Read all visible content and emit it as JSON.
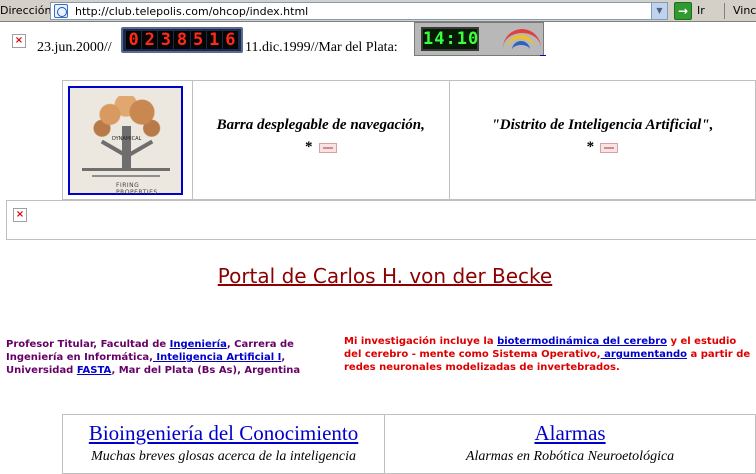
{
  "browser": {
    "address_label": "Dirección",
    "url": "http://club.telepolis.com/ohcop/index.html",
    "go_label": "Ir",
    "links_label": "Vincu"
  },
  "header": {
    "date_left": "23.jun.2000//",
    "counter_digits": [
      "0",
      "2",
      "3",
      "8",
      "5",
      "1",
      "6"
    ],
    "date_right": "11.dic.1999//Mar del Plata:",
    "clock_time": "14:10"
  },
  "nav": {
    "logo_tag": "DYNAMICAL",
    "logo_caption": "FIRING PROPERTIES",
    "cell1_text": "Barra desplegable de navegación,",
    "cell1_star": "*",
    "cell2_text": "\"Distrito de Inteligencia Artificial\",",
    "cell2_star": "*"
  },
  "title": "Portal de Carlos H. von der Becke",
  "info_left": {
    "t1": "Profesor Titular, Facultad de ",
    "l1": "Ingeniería",
    "t2": ", Carrera de Ingeniería en Informática,",
    "l2": " Inteligencia Artificial I",
    "t3": ", Universidad ",
    "l3": "FASTA",
    "t4": ", Mar del Plata (Bs As), Argentina"
  },
  "info_right": {
    "t1": "Mi investigación incluye la ",
    "l1": "biotermodinámica del cerebro",
    "t2": " y el estudio del cerebro - mente como Sistema Operativo,",
    "l2": " argumentando",
    "t3": " a partir de redes neuronales modelizadas de invertebrados."
  },
  "bottom": [
    {
      "head": "Bioingeniería del Conocimiento",
      "sub": "Muchas breves glosas acerca de la inteligencia"
    },
    {
      "head": "Alarmas",
      "sub": "Alarmas en Robótica Neuroetológica"
    }
  ]
}
